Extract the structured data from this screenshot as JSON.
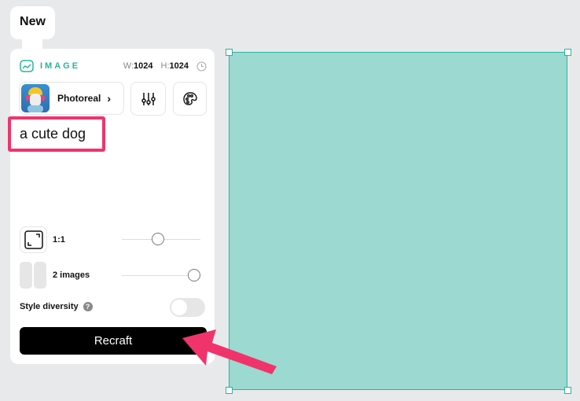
{
  "tab": {
    "label": "New"
  },
  "panel": {
    "title": "IMAGE",
    "width_label": "W:",
    "width": "1024",
    "height_label": "H:",
    "height": "1024",
    "style_label": "Photoreal",
    "prompt": "a cute dog",
    "aspect_ratio": "1:1",
    "aspect_ratio_slider": 0.5,
    "image_count": "2 images",
    "image_count_slider": 1.0,
    "style_diversity_label": "Style diversity",
    "style_diversity_on": false,
    "recraft_label": "Recraft"
  },
  "colors": {
    "accent": "#2ab39c",
    "canvas": "#9bd9d1",
    "highlight": "#f0346b"
  }
}
